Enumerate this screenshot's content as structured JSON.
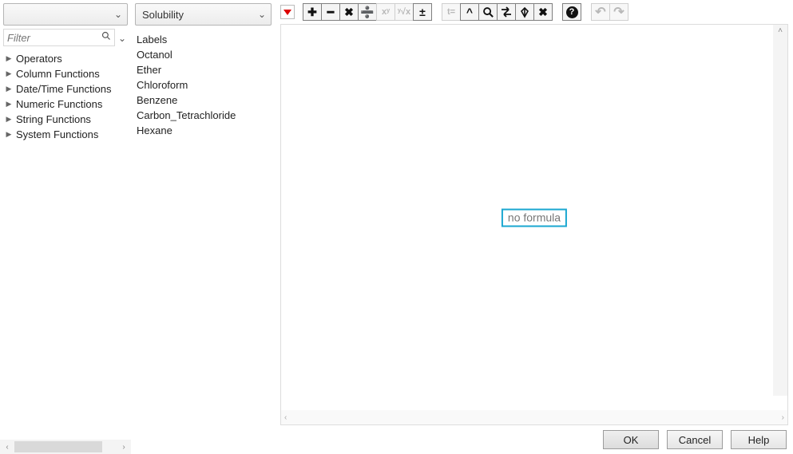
{
  "left": {
    "dropdown_label": "",
    "filter_placeholder": "Filter",
    "categories": [
      "Operators",
      "Column Functions",
      "Date/Time Functions",
      "Numeric Functions",
      "String Functions",
      "System Functions"
    ]
  },
  "mid": {
    "dropdown_label": "Solubility",
    "columns": [
      "Labels",
      "Octanol",
      "Ether",
      "Chloroform",
      "Benzene",
      "Carbon_Tetrachloride",
      "Hexane"
    ]
  },
  "toolbar": {
    "groups": [
      [
        {
          "name": "add",
          "glyph": "✚",
          "title": "Add"
        },
        {
          "name": "subtract",
          "glyph": "━",
          "title": "Subtract"
        },
        {
          "name": "multiply",
          "glyph": "✖",
          "title": "Multiply"
        },
        {
          "name": "divide",
          "glyph": "➗",
          "title": "Divide"
        },
        {
          "name": "power",
          "glyph": "xʸ",
          "title": "Power",
          "disabled": true,
          "small": true
        },
        {
          "name": "root",
          "glyph": "ʸ√x",
          "title": "Root",
          "disabled": true,
          "small": true
        },
        {
          "name": "negate",
          "glyph": "±",
          "title": "Toggle sign"
        }
      ],
      [
        {
          "name": "local",
          "glyph": "t=",
          "title": "Local variable",
          "disabled": true,
          "small": true
        },
        {
          "name": "caret",
          "glyph": "^",
          "title": "Insert caret"
        },
        {
          "name": "magnify",
          "glyph": "svg-magnify",
          "title": "Magnify"
        },
        {
          "name": "swap",
          "glyph": "svg-swap",
          "title": "Swap"
        },
        {
          "name": "peel",
          "glyph": "svg-peel",
          "title": "Peel"
        },
        {
          "name": "delete",
          "glyph": "✖",
          "title": "Delete expression"
        }
      ],
      [
        {
          "name": "help",
          "glyph": "?",
          "title": "Help",
          "circle": true
        }
      ],
      [
        {
          "name": "undo",
          "glyph": "↶",
          "title": "Undo",
          "disabled": true,
          "undo": true
        },
        {
          "name": "redo",
          "glyph": "↷",
          "title": "Redo",
          "disabled": true,
          "undo": true
        }
      ]
    ]
  },
  "editor": {
    "placeholder": "no formula"
  },
  "buttons": {
    "ok": "OK",
    "cancel": "Cancel",
    "help": "Help"
  }
}
